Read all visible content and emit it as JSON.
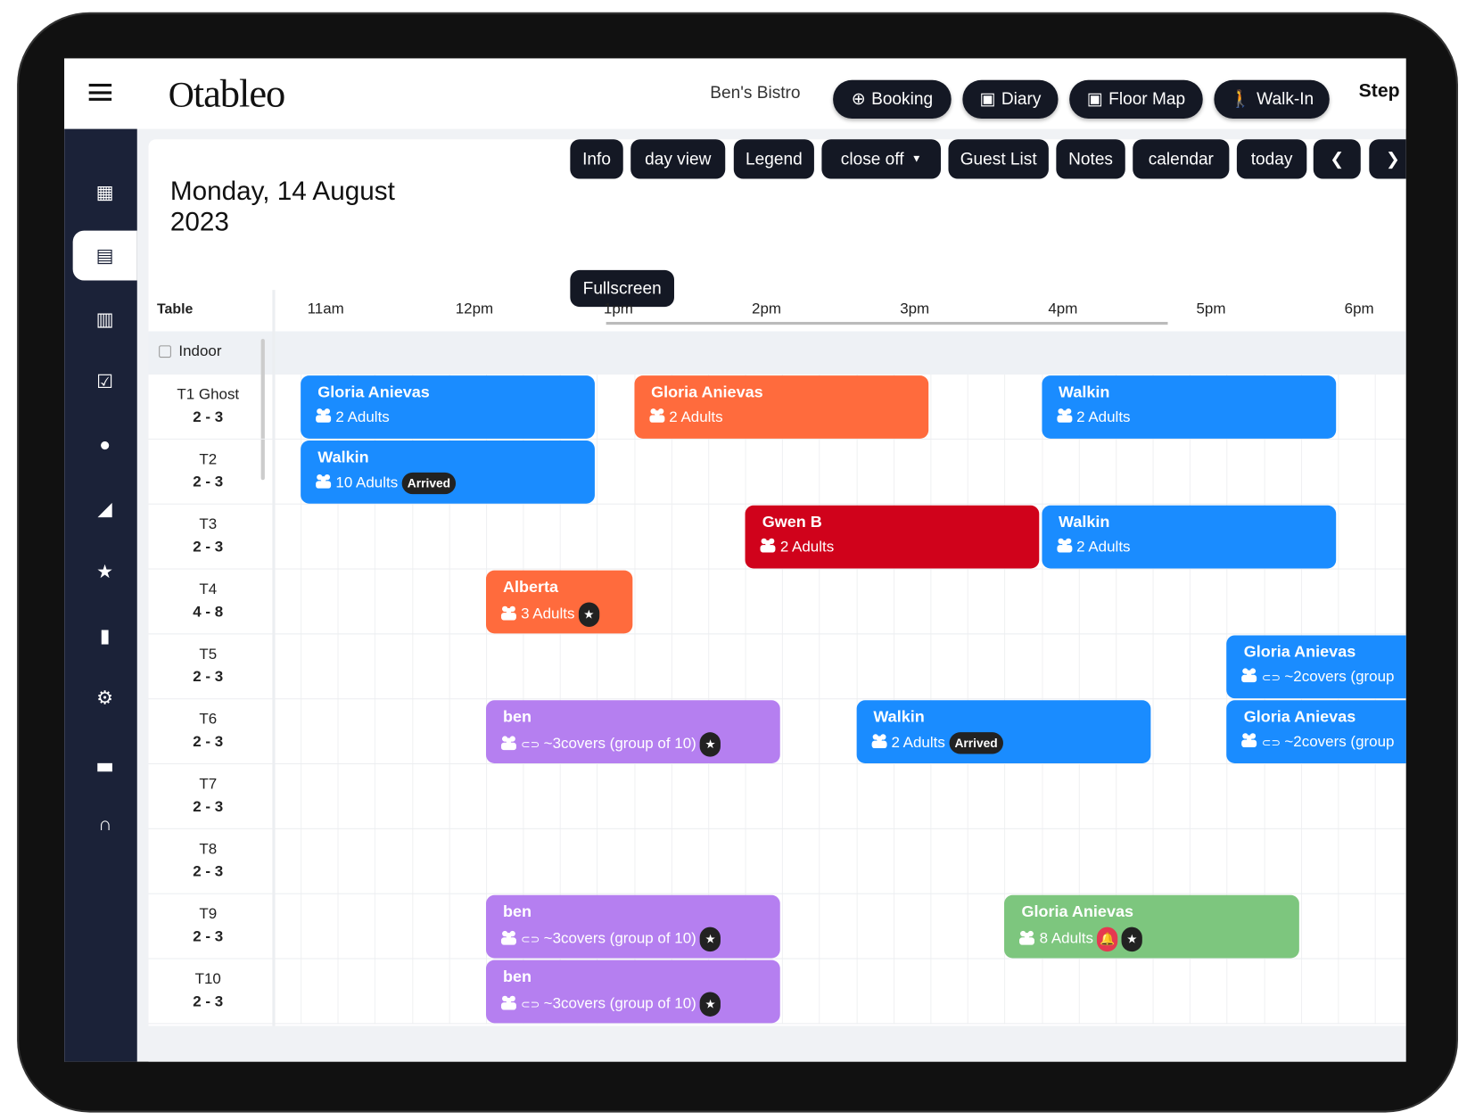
{
  "header": {
    "logo": "tableo",
    "venue": "Ben's Bistro",
    "buttons": [
      {
        "label": "Booking",
        "icon": "plus-circle-icon"
      },
      {
        "label": "Diary",
        "icon": "calendar-icon"
      },
      {
        "label": "Floor Map",
        "icon": "calendar-icon"
      },
      {
        "label": "Walk-In",
        "icon": "walking-icon"
      }
    ],
    "user": "Step"
  },
  "sidebar": {
    "items": [
      "dashboard",
      "calendar",
      "book",
      "checklist",
      "user",
      "chart",
      "star",
      "clipboard",
      "settings",
      "cake",
      "headset"
    ],
    "active": "calendar"
  },
  "main": {
    "date": "Monday, 14 August 2023",
    "toolbar": [
      "Info",
      "day view",
      "Legend",
      "close off",
      "Guest List",
      "Notes",
      "calendar",
      "today"
    ],
    "fullscreen": "Fullscreen",
    "table_header": "Table",
    "hours": [
      "11am",
      "12pm",
      "1pm",
      "2pm",
      "3pm",
      "4pm",
      "5pm",
      "6pm"
    ],
    "section": "Indoor",
    "tables": [
      {
        "name": "T1 Ghost",
        "cap": "2 - 3"
      },
      {
        "name": "T2",
        "cap": "2 - 3"
      },
      {
        "name": "T3",
        "cap": "2 - 3"
      },
      {
        "name": "T4",
        "cap": "4 - 8"
      },
      {
        "name": "T5",
        "cap": "2 - 3"
      },
      {
        "name": "T6",
        "cap": "2 - 3"
      },
      {
        "name": "T7",
        "cap": "2 - 3"
      },
      {
        "name": "T8",
        "cap": "2 - 3"
      },
      {
        "name": "T9",
        "cap": "2 - 3"
      },
      {
        "name": "T10",
        "cap": "2 - 3"
      }
    ],
    "bookings": [
      {
        "table": 0,
        "start": "11:00",
        "end": "13:00",
        "name": "Gloria Anievas",
        "detail": "2 Adults",
        "color": "#1a8cff"
      },
      {
        "table": 0,
        "start": "13:15",
        "end": "15:15",
        "name": "Gloria Anievas",
        "detail": "2 Adults",
        "color": "#ff6b3d"
      },
      {
        "table": 0,
        "start": "16:00",
        "end": "18:00",
        "name": "Walkin",
        "detail": "2 Adults",
        "color": "#1a8cff"
      },
      {
        "table": 1,
        "start": "11:00",
        "end": "13:00",
        "name": "Walkin",
        "detail": "10 Adults",
        "badge": "Arrived",
        "color": "#1a8cff"
      },
      {
        "table": 2,
        "start": "14:00",
        "end": "16:00",
        "name": "Gwen B",
        "detail": "2 Adults",
        "color": "#d0021b"
      },
      {
        "table": 2,
        "start": "16:00",
        "end": "18:00",
        "name": "Walkin",
        "detail": "2 Adults",
        "color": "#1a8cff"
      },
      {
        "table": 3,
        "start": "12:15",
        "end": "13:15",
        "name": "Alberta",
        "detail": "3 Adults",
        "star": true,
        "color": "#ff6b3d"
      },
      {
        "table": 4,
        "start": "17:15",
        "end": "19:15",
        "name": "Gloria Anievas",
        "detail": "~2covers (group",
        "link": true,
        "color": "#1a8cff"
      },
      {
        "table": 5,
        "start": "12:15",
        "end": "14:15",
        "name": "ben",
        "detail": "~3covers (group of 10)",
        "link": true,
        "star": true,
        "color": "#b57ff0"
      },
      {
        "table": 5,
        "start": "14:45",
        "end": "16:45",
        "name": "Walkin",
        "detail": "2 Adults",
        "badge": "Arrived",
        "color": "#1a8cff"
      },
      {
        "table": 5,
        "start": "17:15",
        "end": "19:15",
        "name": "Gloria Anievas",
        "detail": "~2covers (group",
        "link": true,
        "color": "#1a8cff"
      },
      {
        "table": 8,
        "start": "12:15",
        "end": "14:15",
        "name": "ben",
        "detail": "~3covers (group of 10)",
        "link": true,
        "star": true,
        "color": "#b57ff0"
      },
      {
        "table": 8,
        "start": "15:45",
        "end": "17:45",
        "name": "Gloria Anievas",
        "detail": "8 Adults",
        "bell": true,
        "star": true,
        "color": "#7dc67e"
      },
      {
        "table": 9,
        "start": "12:15",
        "end": "14:15",
        "name": "ben",
        "detail": "~3covers (group of 10)",
        "link": true,
        "star": true,
        "color": "#b57ff0"
      }
    ]
  }
}
